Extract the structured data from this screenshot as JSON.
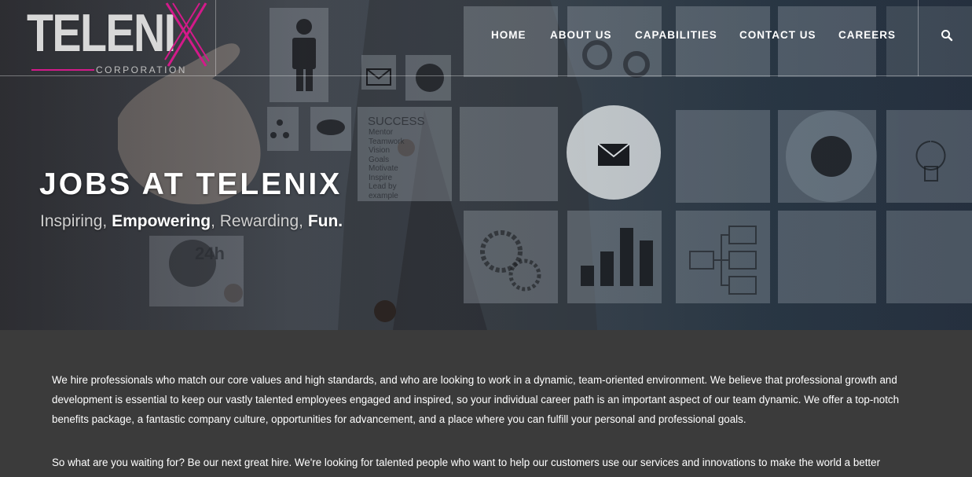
{
  "logo": {
    "wordmark": "TELENI",
    "x_letter": "X",
    "tagline": "CORPORATION"
  },
  "nav": {
    "items": [
      {
        "label": "HOME"
      },
      {
        "label": "ABOUT US"
      },
      {
        "label": "CAPABILITIES"
      },
      {
        "label": "CONTACT US"
      },
      {
        "label": "CAREERS"
      }
    ],
    "search_icon": "search-icon"
  },
  "hero": {
    "title": "JOBS AT TELENIX",
    "subtitle": {
      "w1": "Inspiring,",
      "w2": "Empowering",
      "w3": ", Rewarding,",
      "w4": "Fun."
    },
    "tile_text": {
      "heading": "SUCCESS",
      "items": [
        "Mentor",
        "Teamwork",
        "Vision",
        "Goals",
        "Motivate",
        "Inspire",
        "Lead by",
        "example"
      ],
      "clock": "24h"
    }
  },
  "content": {
    "paragraph1": "We hire professionals who match our core values and high standards, and who are looking to work in a dynamic, team-oriented environment. We believe that professional growth and development is essential to keep our vastly talented employees engaged and inspired, so your individual career path is an important aspect of our team dynamic. We offer a top-notch benefits package, a fantastic company culture, opportunities for advancement, and a place where you can fulfill your personal and professional goals.",
    "paragraph2": "So what are you waiting for? Be our next great hire. We're looking for talented people who want to help our customers use our services and innovations to make the world a better"
  },
  "colors": {
    "brand_accent": "#d31a8a",
    "content_bg": "#3b3b3b"
  }
}
